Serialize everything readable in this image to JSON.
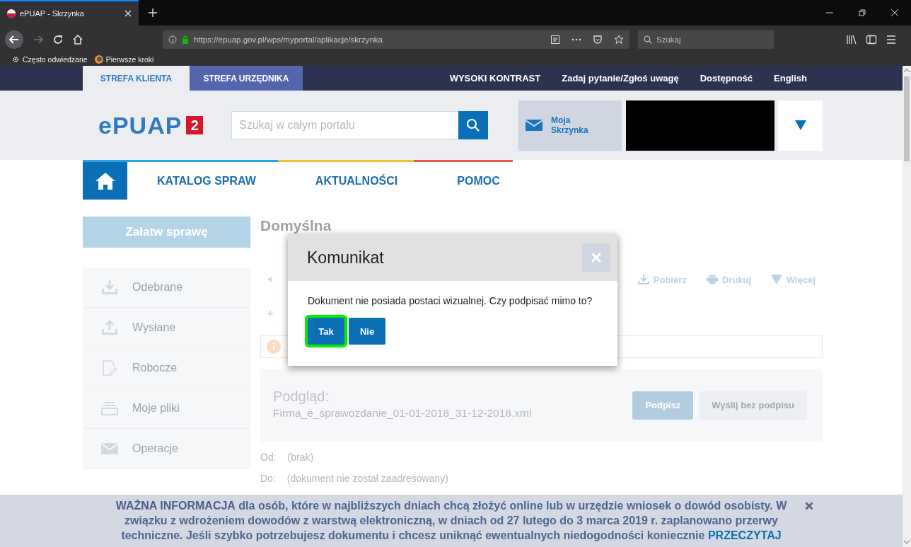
{
  "browser": {
    "tab_title": "ePUAP - Skrzynka",
    "url": "https://epuap.gov.pl/wps/myportal/aplikacje/skrzynka",
    "search_placeholder": "Szukaj",
    "bookmarks": [
      "Często odwiedzane",
      "Pierwsze kroki"
    ]
  },
  "top_nav": {
    "zones": [
      {
        "label": "STREFA KLIENTA",
        "selected": true
      },
      {
        "label": "STREFA URZĘDNIKA",
        "selected": false
      }
    ],
    "links": [
      "WYSOKI KONTRAST",
      "Zadaj pytanie/Zgłoś uwagę",
      "Dostępność",
      "English"
    ]
  },
  "header": {
    "logo": "ePUAP",
    "logo_badge": "2",
    "search_placeholder": "Szukaj w całym portalu",
    "mailbox": "Moja Skrzynka"
  },
  "menu": [
    "KATALOG SPRAW",
    "AKTUALNOŚCI",
    "POMOC"
  ],
  "sidebar": {
    "action": "Załatw sprawę",
    "items": [
      "Odebrane",
      "Wysłane",
      "Robocze",
      "Moje pliki",
      "Operacje"
    ]
  },
  "content": {
    "title": "Domyślna",
    "toolbar": [
      "Pobierz",
      "Drukuj",
      "Więcej"
    ],
    "preview_label": "Podgląd:",
    "file_name": "Firma_e_sprawozdanie_01-01-2018_31-12-2018.xml",
    "buttons": [
      {
        "label": "Podpisz",
        "disabled": false
      },
      {
        "label": "Wyślij bez podpisu",
        "disabled": true
      }
    ],
    "meta": [
      {
        "label": "Od:",
        "value": "(brak)"
      },
      {
        "label": "Do:",
        "value": "(dokument nie został zaadresowany)"
      }
    ]
  },
  "dialog": {
    "title": "Komunikat",
    "message": "Dokument nie posiada postaci wizualnej. Czy podpisać mimo to?",
    "buttons": [
      {
        "label": "Tak",
        "selected": true
      },
      {
        "label": "Nie",
        "selected": false
      }
    ]
  },
  "banner": {
    "text": "**WAŻNA INFORMACJA** dla osób, które w najbliższych dniach chcą złożyć online lub w urzędzie wniosek o dowód osobisty. W związku z wdrożeniem dowodów z warstwą elektroniczną, w dniach od 27 lutego do 3 marca 2019 r. zaplanowano przerwy techniczne. Jeśli szybko potrzebujesz dokumentu i chcesz uniknąć ewentualnych niedogodności koniecznie",
    "link": "PRZECZYTAJ"
  }
}
